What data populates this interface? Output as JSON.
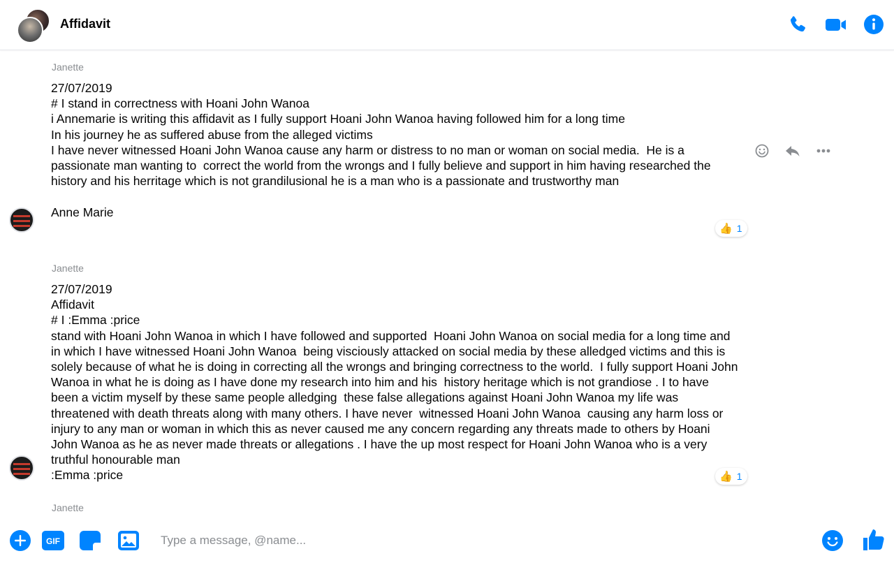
{
  "header": {
    "title": "Affidavit",
    "accent_color": "#0084ff",
    "icons": [
      "phone-icon",
      "video-camera-icon",
      "info-icon"
    ]
  },
  "messages": [
    {
      "sender": "Janette",
      "text": "27/07/2019\n# I stand in correctness with Hoani John Wanoa\ni Annemarie is writing this affidavit as I fully support Hoani John Wanoa having followed him for a long time\nIn his journey he as suffered abuse from the alleged victims\nI have never witnessed Hoani John Wanoa cause any harm or distress to no man or woman on social media.  He is a passionate man wanting to  correct the world from the wrongs and I fully believe and support in him having researched the history and his herritage which is not grandilusional he is a man who is a passionate and trustworthy man\n\nAnne Marie",
      "reaction_emoji": "👍",
      "reaction_count": "1"
    },
    {
      "sender": "Janette",
      "text": "27/07/2019\nAffidavit\n# I :Emma :price\nstand with Hoani John Wanoa in which I have followed and supported  Hoani John Wanoa on social media for a long time and in which I have witnessed Hoani John Wanoa  being visciously attacked on social media by these alledged victims and this is solely because of what he is doing in correcting all the wrongs and bringing correctness to the world.  I fully support Hoani John Wanoa in what he is doing as I have done my research into him and his  history heritage which is not grandiose . I to have been a victim myself by these same people alledging  these false allegations against Hoani John Wanoa my life was threatened with death threats along with many others. I have never  witnessed Hoani John Wanoa  causing any harm loss or injury to any man or woman in which this as never caused me any concern regarding any threats made to others by Hoani John Wanoa as he as never made threats or allegations . I have the up most respect for Hoani John Wanoa who is a very truthful honourable man\n:Emma :price",
      "reaction_emoji": "👍",
      "reaction_count": "1"
    },
    {
      "sender": "Janette"
    }
  ],
  "message_actions": [
    "smiley-react-icon",
    "reply-icon",
    "more-dots-icon"
  ],
  "composer": {
    "placeholder": "Type a message, @name...",
    "gif_label": "GIF",
    "icons": [
      "plus-icon",
      "gif-icon",
      "sticker-icon",
      "image-icon",
      "emoji-icon",
      "thumbs-up-icon"
    ]
  }
}
